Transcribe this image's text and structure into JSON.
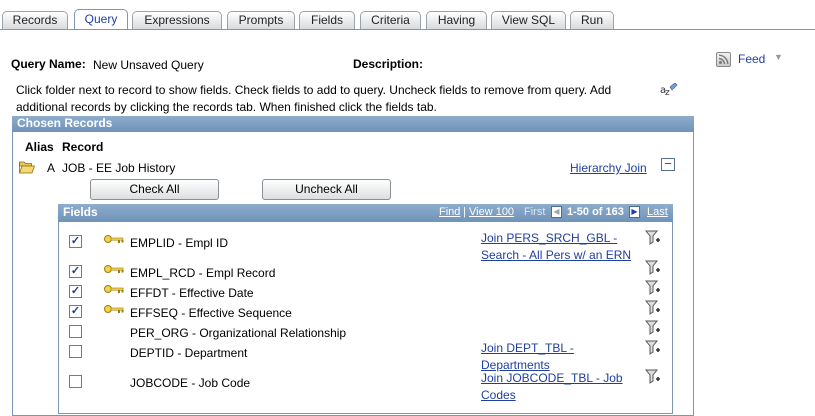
{
  "tabs": [
    {
      "label": "Records"
    },
    {
      "label": "Query"
    },
    {
      "label": "Expressions"
    },
    {
      "label": "Prompts"
    },
    {
      "label": "Fields"
    },
    {
      "label": "Criteria"
    },
    {
      "label": "Having"
    },
    {
      "label": "View SQL"
    },
    {
      "label": "Run"
    }
  ],
  "active_tab": "Query",
  "query": {
    "name_label": "Query Name:",
    "name_value": "New Unsaved Query",
    "description_label": "Description:"
  },
  "feed": {
    "label": "Feed"
  },
  "instructions": {
    "line1": "Click folder next to record to show fields. Check fields to add to query. Uncheck fields to remove from query. Add",
    "line2": "additional records by clicking the records tab. When finished click the fields tab."
  },
  "chosen_records": {
    "title": "Chosen Records",
    "alias_header": "Alias",
    "record_header": "Record",
    "alias": "A",
    "record": "JOB - EE Job History",
    "hierarchy_join": "Hierarchy Join",
    "check_all": "Check All",
    "uncheck_all": "Uncheck All"
  },
  "fields_grid": {
    "title": "Fields",
    "find": "Find",
    "view": "View 100",
    "first": "First",
    "range": "1-50 of 163",
    "last": "Last",
    "rows": [
      {
        "checked": true,
        "key": true,
        "label": "EMPLID - Empl ID",
        "join1": "Join PERS_SRCH_GBL -",
        "join2": "Search - All Pers w/ an ERN"
      },
      {
        "checked": true,
        "key": true,
        "label": "EMPL_RCD - Empl Record",
        "join1": "",
        "join2": ""
      },
      {
        "checked": true,
        "key": true,
        "label": "EFFDT - Effective Date",
        "join1": "",
        "join2": ""
      },
      {
        "checked": true,
        "key": true,
        "label": "EFFSEQ - Effective Sequence",
        "join1": "",
        "join2": ""
      },
      {
        "checked": false,
        "key": false,
        "label": "PER_ORG - Organizational Relationship",
        "join1": "",
        "join2": ""
      },
      {
        "checked": false,
        "key": false,
        "label": "DEPTID - Department",
        "join1": "Join DEPT_TBL -",
        "join2": "Departments"
      },
      {
        "checked": false,
        "key": false,
        "label": "JOBCODE - Job Code",
        "join1": "Join JOBCODE_TBL - Job",
        "join2": "Codes"
      }
    ]
  },
  "colors": {
    "header_blue": "#6f93ba",
    "link_blue": "#1f3f9e",
    "key_gold": "#d9b227"
  }
}
